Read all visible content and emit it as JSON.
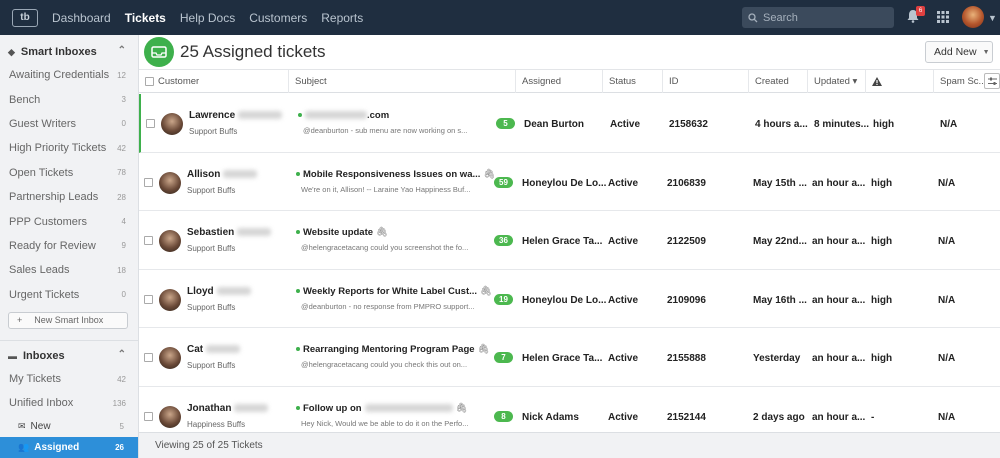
{
  "nav": {
    "logo_text": "tb",
    "items": [
      "Dashboard",
      "Tickets",
      "Help Docs",
      "Customers",
      "Reports"
    ],
    "active_index": 1,
    "search_placeholder": "Search",
    "notification_count": "6"
  },
  "sidebar": {
    "smart_inboxes_label": "Smart Inboxes",
    "smart_items": [
      {
        "label": "Awaiting Credentials",
        "count": "12"
      },
      {
        "label": "Bench",
        "count": "3"
      },
      {
        "label": "Guest Writers",
        "count": "0"
      },
      {
        "label": "High Priority Tickets",
        "count": "42"
      },
      {
        "label": "Open Tickets",
        "count": "78"
      },
      {
        "label": "Partnership Leads",
        "count": "28"
      },
      {
        "label": "PPP Customers",
        "count": "4"
      },
      {
        "label": "Ready for Review",
        "count": "9"
      },
      {
        "label": "Sales Leads",
        "count": "18"
      },
      {
        "label": "Urgent Tickets",
        "count": "0"
      }
    ],
    "new_smart_inbox_label": "New Smart Inbox",
    "inboxes_label": "Inboxes",
    "inbox_items": [
      {
        "label": "My Tickets",
        "count": "42"
      },
      {
        "label": "Unified Inbox",
        "count": "136"
      }
    ],
    "sub_items": [
      {
        "label": "New",
        "count": "5"
      },
      {
        "label": "Assigned",
        "count": "26"
      }
    ]
  },
  "main": {
    "title": "25 Assigned tickets",
    "add_new_label": "Add New",
    "columns": [
      "Customer",
      "Subject",
      "Assigned",
      "Status",
      "ID",
      "Created",
      "Updated ▾",
      "",
      "Spam Sc..."
    ],
    "rows": [
      {
        "name": "Lawrence",
        "company": "Support Buffs",
        "subject": ".com",
        "preview": "@deanburton  - sub menu are now working on s...",
        "count": "5",
        "assigned": "Dean Burton",
        "status": "Active",
        "id": "2158632",
        "created": "4 hours a...",
        "updated": "8 minutes...",
        "priority": "high",
        "spam": "N/A",
        "attach": false
      },
      {
        "name": "Allison",
        "company": "Support Buffs",
        "subject": "Mobile Responsiveness Issues on wa...",
        "preview": "We're on it, Allison! -- Laraine Yao Happiness Buf...",
        "count": "59",
        "assigned": "Honeylou De Lo...",
        "status": "Active",
        "id": "2106839",
        "created": "May 15th ...",
        "updated": "an hour a...",
        "priority": "high",
        "spam": "N/A",
        "attach": true
      },
      {
        "name": "Sebastien",
        "company": "Support Buffs",
        "subject": "Website update",
        "preview": "@helengracetacang  could you screenshot the fo...",
        "count": "36",
        "assigned": "Helen Grace Ta...",
        "status": "Active",
        "id": "2122509",
        "created": "May 22nd...",
        "updated": "an hour a...",
        "priority": "high",
        "spam": "N/A",
        "attach": true
      },
      {
        "name": "Lloyd",
        "company": "Support Buffs",
        "subject": "Weekly Reports for White Label Cust...",
        "preview": "@deanburton  - no response from PMPRO support...",
        "count": "19",
        "assigned": "Honeylou De Lo...",
        "status": "Active",
        "id": "2109096",
        "created": "May 16th ...",
        "updated": "an hour a...",
        "priority": "high",
        "spam": "N/A",
        "attach": true
      },
      {
        "name": "Cat",
        "company": "Support Buffs",
        "subject": "Rearranging Mentoring Program Page",
        "preview": "@helengracetacang  could you check this out on...",
        "count": "7",
        "assigned": "Helen Grace Ta...",
        "status": "Active",
        "id": "2155888",
        "created": "Yesterday",
        "updated": "an hour a...",
        "priority": "high",
        "spam": "N/A",
        "attach": true
      },
      {
        "name": "Jonathan",
        "company": "Happiness Buffs",
        "subject": "Follow up on",
        "preview": "Hey Nick, Would we be able to do it on the Perfo...",
        "count": "8",
        "assigned": "Nick Adams",
        "status": "Active",
        "id": "2152144",
        "created": "2 days ago",
        "updated": "an hour a...",
        "priority": "-",
        "spam": "N/A",
        "attach": true
      }
    ],
    "footer_text": "Viewing 25 of 25 Tickets"
  },
  "colors": {
    "nav_bg": "#1f2e40",
    "accent_green": "#3eb04c",
    "active_blue": "#2d8fd9"
  }
}
